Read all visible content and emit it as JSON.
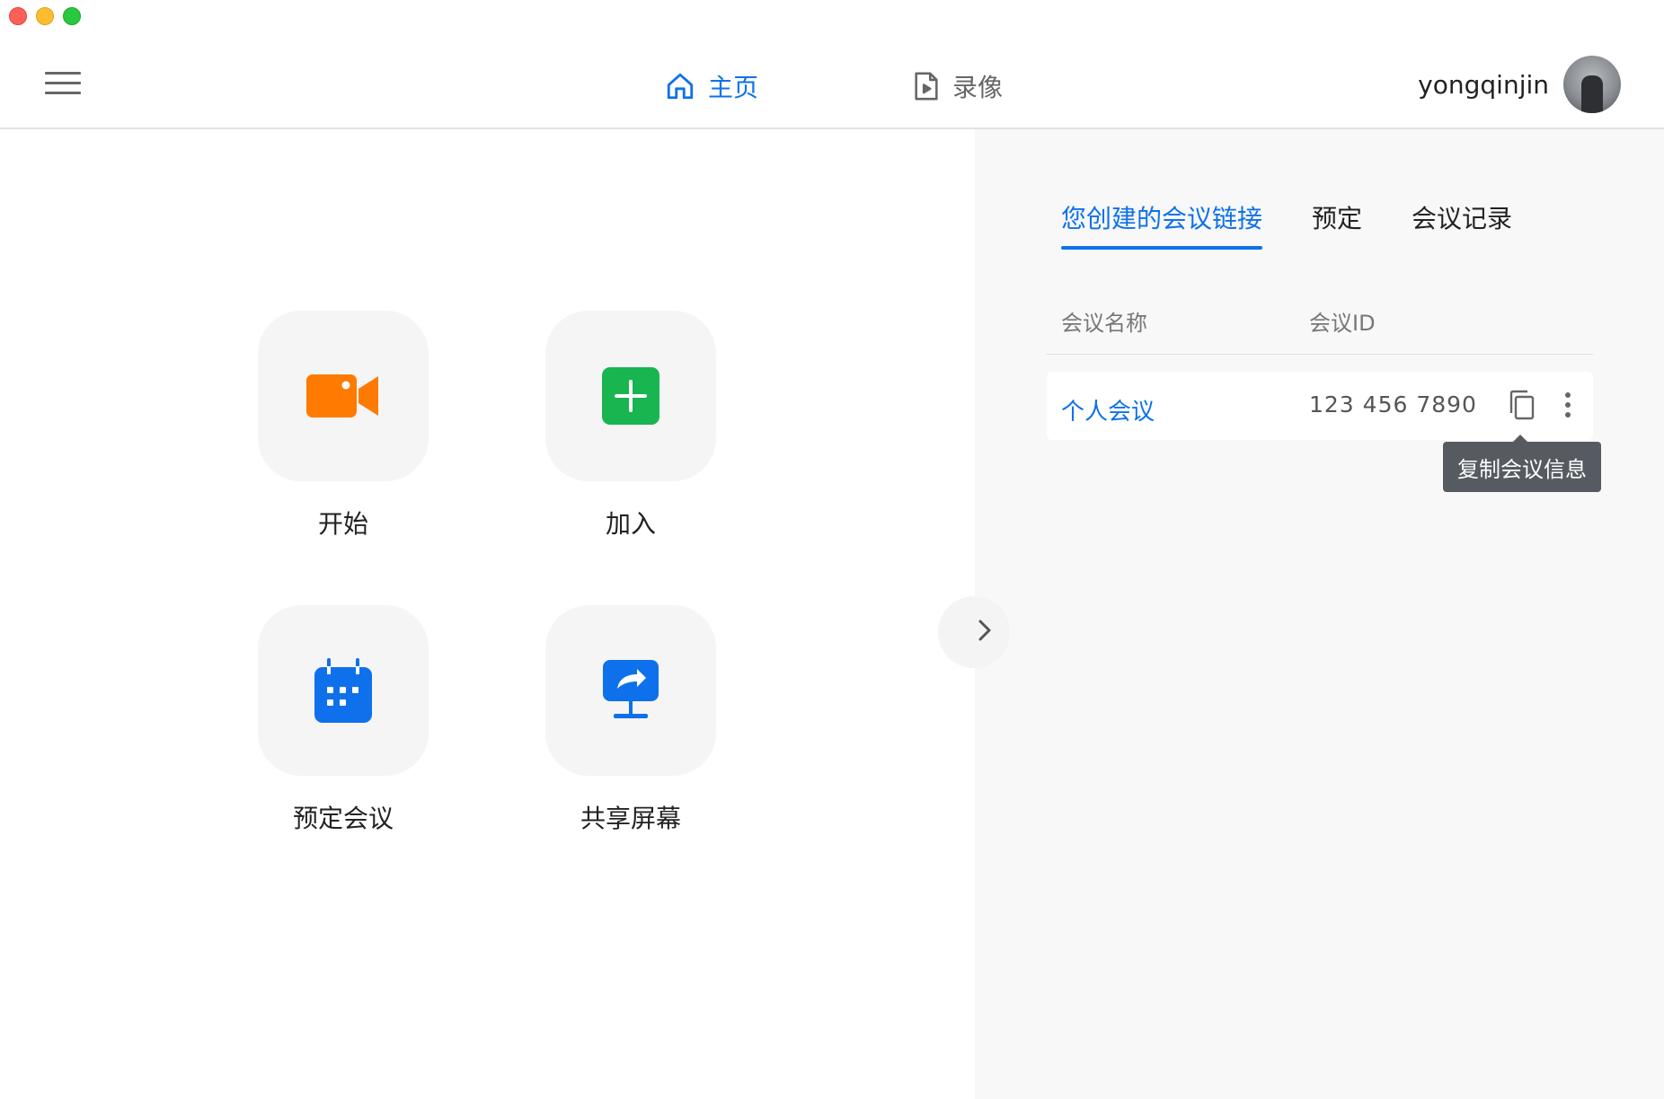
{
  "nav": {
    "home_label": "主页",
    "recordings_label": "录像"
  },
  "user": {
    "name": "yongqinjin"
  },
  "actions": [
    {
      "label": "开始",
      "icon": "video-camera-icon",
      "color": "#ff7a00"
    },
    {
      "label": "加入",
      "icon": "plus-icon",
      "color": "#18b550"
    },
    {
      "label": "预定会议",
      "icon": "calendar-icon",
      "color": "#0e71eb"
    },
    {
      "label": "共享屏幕",
      "icon": "share-screen-icon",
      "color": "#0e71eb"
    }
  ],
  "meetings_panel": {
    "tabs": [
      "您创建的会议链接",
      "预定",
      "会议记录"
    ],
    "active_tab": "您创建的会议链接",
    "columns": [
      "会议名称",
      "会议ID"
    ],
    "rows": [
      {
        "name": "个人会议",
        "meeting_id": "123 456 7890"
      }
    ],
    "tooltip": "复制会议信息"
  },
  "colors": {
    "accent": "#0e71eb",
    "tooltip_bg": "#565a61"
  }
}
